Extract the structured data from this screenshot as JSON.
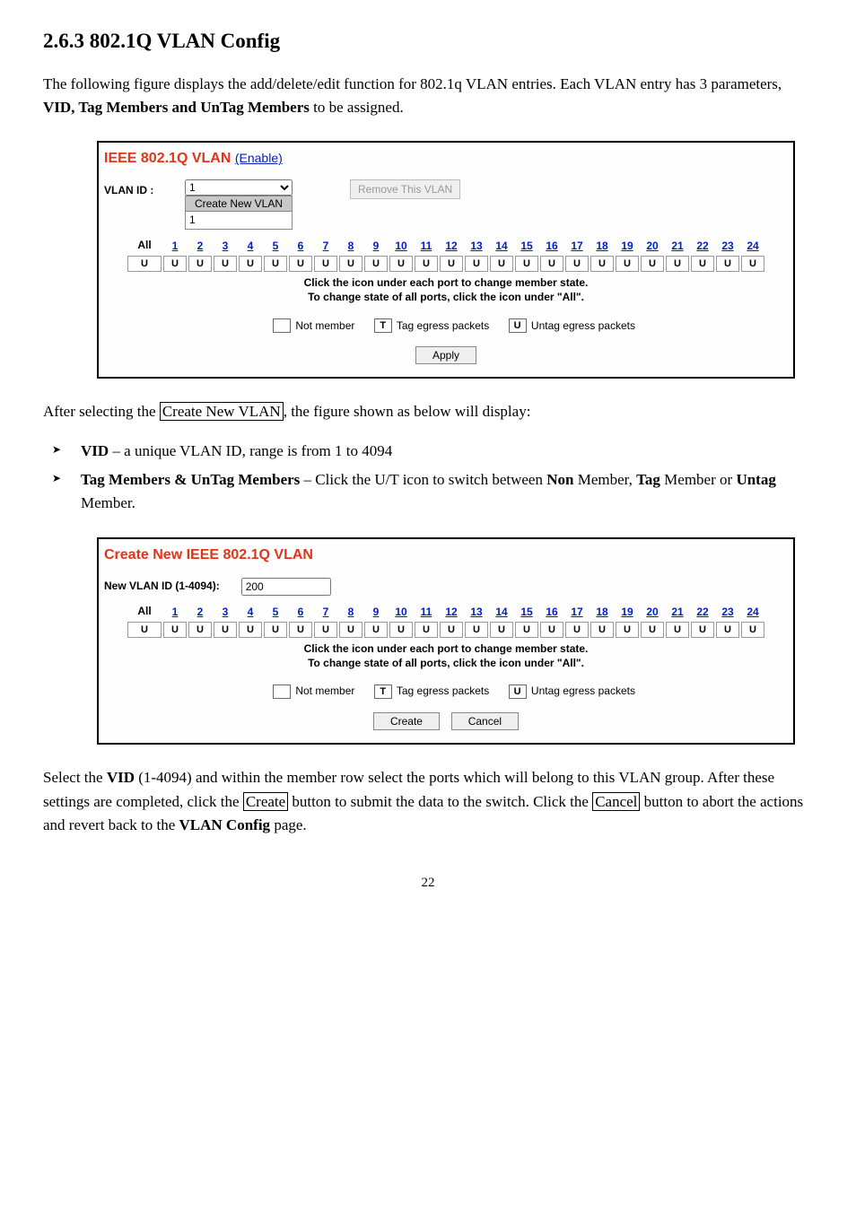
{
  "heading": "2.6.3   802.1Q VLAN Config",
  "intro_text": "The following figure displays the add/delete/edit function for 802.1q VLAN entries. Each VLAN entry has 3 parameters, ",
  "intro_bold": "VID, Tag Members and UnTag Members",
  "intro_tail": " to be assigned.",
  "panel1": {
    "title": "IEEE 802.1Q VLAN",
    "enable_link": "(Enable)",
    "vlan_id_label": "VLAN ID :",
    "vlan_id_value": "1",
    "create_btn": "Create New VLAN",
    "dropdown_option": "1",
    "remove_btn": "Remove This VLAN",
    "all_label": "All",
    "all_state": "U",
    "ports": [
      "1",
      "2",
      "3",
      "4",
      "5",
      "6",
      "7",
      "8",
      "9",
      "10",
      "11",
      "12",
      "13",
      "14",
      "15",
      "16",
      "17",
      "18",
      "19",
      "20",
      "21",
      "22",
      "23",
      "24"
    ],
    "port_states": [
      "U",
      "U",
      "U",
      "U",
      "U",
      "U",
      "U",
      "U",
      "U",
      "U",
      "U",
      "U",
      "U",
      "U",
      "U",
      "U",
      "U",
      "U",
      "U",
      "U",
      "U",
      "U",
      "U",
      "U"
    ],
    "hint_line1": "Click the icon under each port to change member state.",
    "hint_line2": "To change state of all ports, click the icon under \"All\".",
    "legend_notmember": "Not member",
    "legend_tag_box": "T",
    "legend_tag": "Tag egress packets",
    "legend_untag_box": "U",
    "legend_untag": "Untag egress packets",
    "apply_btn": "Apply"
  },
  "after1_a": "After selecting the ",
  "after1_box": "Create New VLAN",
  "after1_b": ", the figure shown as below will display:",
  "bullet1_label": "VID",
  "bullet1_text": " – a unique VLAN ID, range is from 1 to 4094",
  "bullet2_label": "Tag Members & UnTag Members",
  "bullet2_mid": " – Click the U/T icon to switch between ",
  "bullet2_non": "Non",
  "bullet2_mid2": " Member, ",
  "bullet2_tag": "Tag",
  "bullet2_mid3": " Member or ",
  "bullet2_untag": "Untag",
  "bullet2_tail": " Member.",
  "panel2": {
    "title": "Create New IEEE 802.1Q VLAN",
    "new_vlan_label": "New VLAN ID (1-4094):",
    "new_vlan_value": "200",
    "all_label": "All",
    "all_state": "U",
    "ports": [
      "1",
      "2",
      "3",
      "4",
      "5",
      "6",
      "7",
      "8",
      "9",
      "10",
      "11",
      "12",
      "13",
      "14",
      "15",
      "16",
      "17",
      "18",
      "19",
      "20",
      "21",
      "22",
      "23",
      "24"
    ],
    "port_states": [
      "U",
      "U",
      "U",
      "U",
      "U",
      "U",
      "U",
      "U",
      "U",
      "U",
      "U",
      "U",
      "U",
      "U",
      "U",
      "U",
      "U",
      "U",
      "U",
      "U",
      "U",
      "U",
      "U",
      "U"
    ],
    "hint_line1": "Click the icon under each port to change member state.",
    "hint_line2": "To change state of all ports, click the icon under \"All\".",
    "legend_notmember": "Not member",
    "legend_tag_box": "T",
    "legend_tag": "Tag egress packets",
    "legend_untag_box": "U",
    "legend_untag": "Untag egress packets",
    "create_btn": "Create",
    "cancel_btn": "Cancel"
  },
  "after2_a": "Select the ",
  "after2_vid": "VID",
  "after2_b": " (1-4094) and within the member row select the ports which will belong to this VLAN group. After these settings are completed, click the ",
  "after2_create": "Create",
  "after2_c": " button to submit the data to the switch. Click the ",
  "after2_cancel": "Cancel",
  "after2_d": " button to abort the actions and revert back to the ",
  "after2_vlanconfig": "VLAN Config",
  "after2_e": " page.",
  "page_number": "22"
}
